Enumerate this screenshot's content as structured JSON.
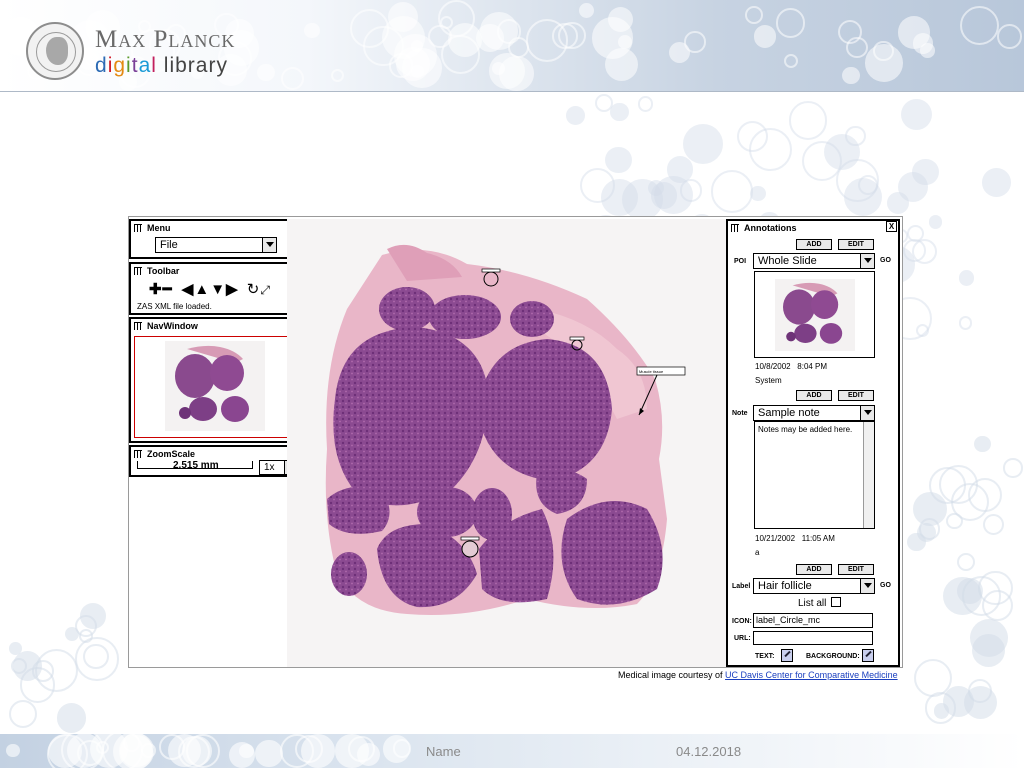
{
  "slide": {
    "brand_line1": "Max Planck",
    "brand_line2": [
      "d",
      "i",
      "g",
      "i",
      "t",
      "a",
      "l",
      " ",
      "l",
      "i",
      "b",
      "r",
      "a",
      "r",
      "y"
    ],
    "brand_colors": [
      "#2d6bb5",
      "#d11c2b",
      "#e48a12",
      "#5a9a2c",
      "#7a3f97",
      "#1a9ad6",
      "#c21f5d",
      "#333",
      "#444",
      "#444",
      "#444",
      "#444",
      "#444",
      "#444",
      "#444"
    ],
    "footer_name": "Name",
    "footer_date": "04.12.2018",
    "credit_prefix": "Medical image courtesy of ",
    "credit_link": "UC Davis Center for Comparative Medicine"
  },
  "menu_panel": {
    "title": "Menu",
    "file_select": "File"
  },
  "toolbar_panel": {
    "title": "Toolbar",
    "icons": [
      "zoom-in-icon",
      "zoom-out-icon",
      "pan-left-icon",
      "pan-up-icon",
      "pan-down-icon",
      "pan-right-icon",
      "rotate-icon",
      "resize-icon"
    ],
    "status_text": "ZAS XML file loaded."
  },
  "nav_panel": {
    "title": "NavWindow"
  },
  "zoom_panel": {
    "title": "ZoomScale",
    "scale_text": "2.515 mm",
    "zoom_select": "1x"
  },
  "viewer": {
    "marker_label": "Muscle tissue"
  },
  "annotations": {
    "title": "Annotations",
    "add_label": "ADD",
    "edit_label": "EDIT",
    "go_label": "GO",
    "poi_label": "POI",
    "poi_select": "Whole Slide",
    "poi_date": "10/8/2002",
    "poi_time": "8:04 PM",
    "poi_author": "System",
    "note_label": "Note",
    "note_select": "Sample note",
    "note_text": "Notes may be added here.",
    "note_date": "10/21/2002",
    "note_time": "11:05 AM",
    "note_author": "a",
    "label_label": "Label",
    "label_select": "Hair follicle",
    "list_all": "List all",
    "icon_label": "ICON:",
    "icon_value": "label_Circle_mc",
    "url_label": "URL:",
    "url_value": "",
    "text_label": "TEXT:",
    "background_label": "BACKGROUND:",
    "accent_color": "#c9cfee"
  }
}
